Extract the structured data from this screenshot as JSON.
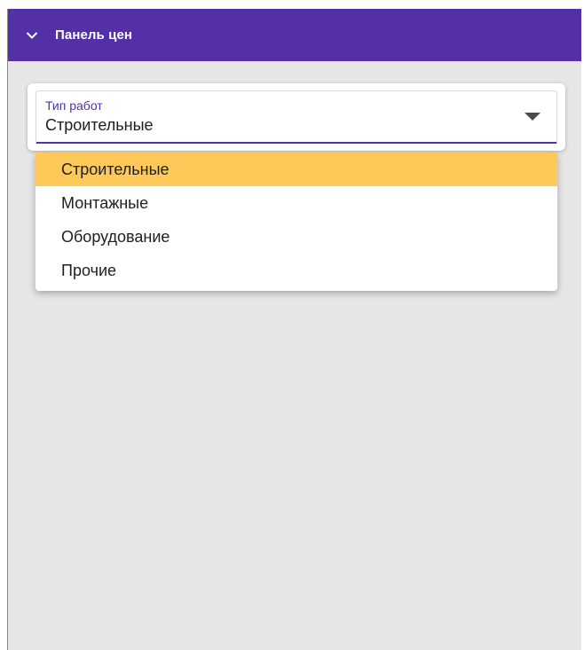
{
  "panel": {
    "title": "Панель цен",
    "header_icon": "chevron-down-icon",
    "colors": {
      "header_bg": "#5330a8",
      "panel_bg": "#e6e6e6",
      "selected_item_bg": "#ffc95a",
      "accent": "#5330a8"
    }
  },
  "select": {
    "label": "Тип работ",
    "value": "Строительные",
    "icon": "dropdown-arrow-icon"
  },
  "menu": {
    "items": [
      {
        "label": "Строительные",
        "selected": true
      },
      {
        "label": "Монтажные",
        "selected": false
      },
      {
        "label": "Оборудование",
        "selected": false
      },
      {
        "label": "Прочие",
        "selected": false
      }
    ]
  }
}
